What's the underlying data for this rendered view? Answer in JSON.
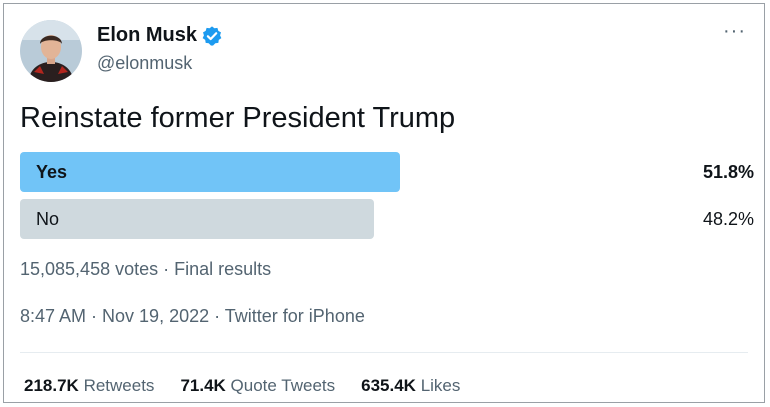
{
  "author": {
    "name": "Elon Musk",
    "handle": "@elonmusk"
  },
  "menu": {
    "more_label": "···"
  },
  "poll": {
    "question": "Reinstate former President Trump",
    "options": [
      {
        "label": "Yes",
        "percent_text": "51.8%",
        "percent": 51.8,
        "winner": true
      },
      {
        "label": "No",
        "percent_text": "48.2%",
        "percent": 48.2,
        "winner": false
      }
    ],
    "summary": "15,085,458 votes · Final results"
  },
  "timestamp": "8:47 AM · Nov 19, 2022 · Twitter for iPhone",
  "stats": {
    "retweets_count": "218.7K",
    "retweets_label": "Retweets",
    "quotes_count": "71.4K",
    "quotes_label": "Quote Tweets",
    "likes_count": "635.4K",
    "likes_label": "Likes"
  },
  "colors": {
    "winner_bar": "#71c4f7",
    "other_bar": "#cfd9de",
    "verified": "#1d9bf0"
  }
}
